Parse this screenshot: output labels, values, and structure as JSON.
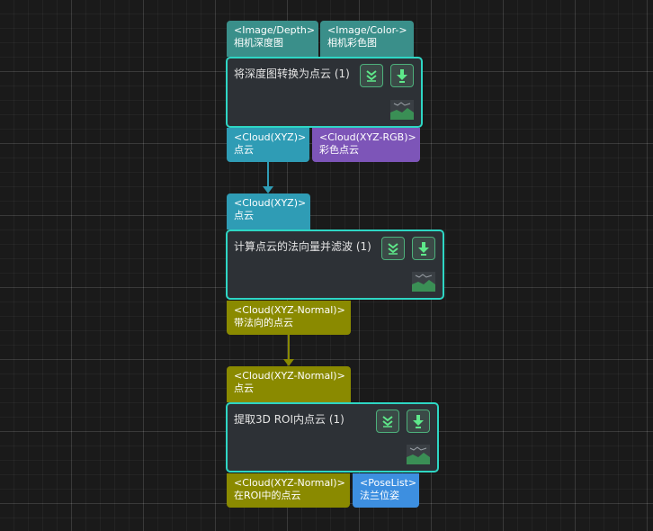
{
  "nodes": [
    {
      "title": "将深度图转换为点云 (1)",
      "inputs": [
        {
          "type": "<Image/Depth>",
          "label": "相机深度图"
        },
        {
          "type": "<Image/Color->",
          "label": "相机彩色图"
        }
      ],
      "outputs": [
        {
          "type": "<Cloud(XYZ)>",
          "label": "点云"
        },
        {
          "type": "<Cloud(XYZ-RGB)>",
          "label": "彩色点云"
        }
      ]
    },
    {
      "title": "计算点云的法向量并滤波 (1)",
      "inputs": [
        {
          "type": "<Cloud(XYZ)>",
          "label": "点云"
        }
      ],
      "outputs": [
        {
          "type": "<Cloud(XYZ-Normal)>",
          "label": "带法向的点云"
        }
      ]
    },
    {
      "title": "提取3D ROI内点云 (1)",
      "inputs": [
        {
          "type": "<Cloud(XYZ-Normal)>",
          "label": "点云"
        }
      ],
      "outputs": [
        {
          "type": "<Cloud(XYZ-Normal)>",
          "label": "在ROI中的点云"
        },
        {
          "type": "<PoseList>",
          "label": "法兰位姿"
        }
      ]
    }
  ],
  "icons": {
    "collapse": "chevrons-down-icon",
    "debug": "download-arrow-icon",
    "visual": "landscape-image-icon"
  },
  "colors": {
    "node_border": "#2ed6c4",
    "image_port": "#3a8f8a",
    "cloud_xyz_port": "#2f9cb5",
    "cloud_rgb_port": "#7d55b8",
    "cloud_normal_port": "#8a8a00",
    "poselist_port": "#3d8fe0",
    "button_icon": "#5ee88a"
  }
}
